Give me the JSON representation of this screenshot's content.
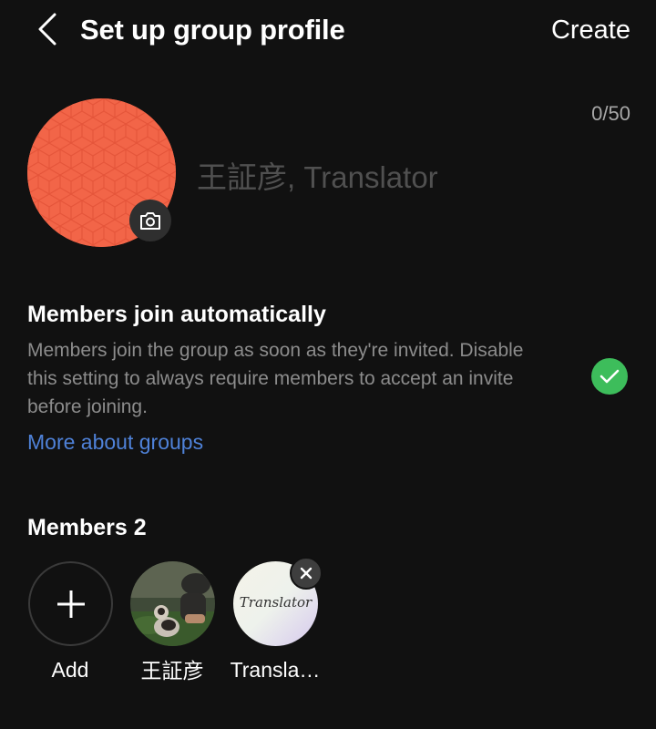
{
  "header": {
    "title": "Set up group profile",
    "create_label": "Create"
  },
  "group": {
    "name_counter": "0/50",
    "name_placeholder": "王証彦, Translator",
    "avatar_color": "#f26548"
  },
  "auto_join": {
    "title": "Members join automatically",
    "description": "Members join the group as soon as they're invited. Disable this setting to always require members to accept an invite before joining.",
    "link": "More about groups",
    "enabled": true
  },
  "members": {
    "heading": "Members 2",
    "add_label": "Add",
    "list": [
      {
        "name": "王証彦"
      },
      {
        "name": "Transla…",
        "avatar_text": "Translator"
      }
    ]
  },
  "colors": {
    "background": "#111111",
    "accent_green": "#3dbd5b",
    "link_blue": "#4f82d9"
  }
}
